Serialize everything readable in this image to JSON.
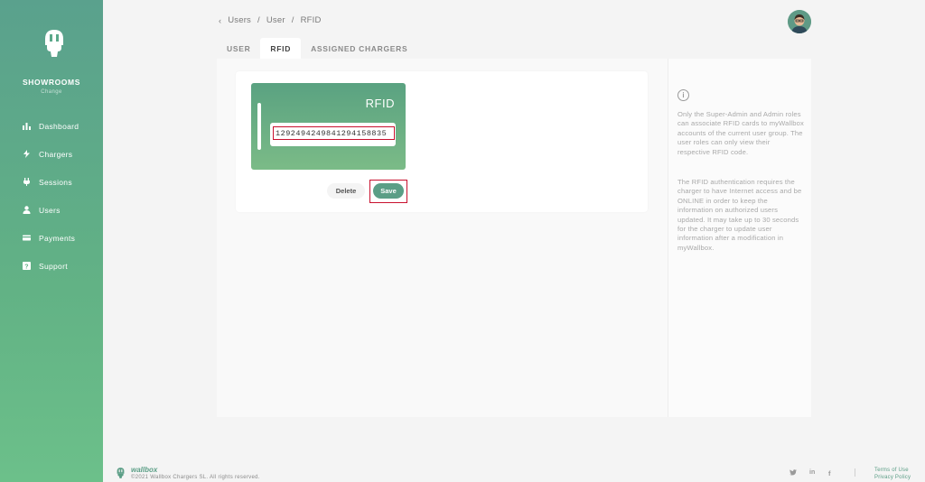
{
  "sidebar": {
    "group_name": "SHOWROOMS",
    "group_change": "Change",
    "items": [
      {
        "label": "Dashboard",
        "icon": "bar-chart-icon"
      },
      {
        "label": "Chargers",
        "icon": "lightning-icon"
      },
      {
        "label": "Sessions",
        "icon": "plug-icon"
      },
      {
        "label": "Users",
        "icon": "user-icon"
      },
      {
        "label": "Payments",
        "icon": "credit-card-icon"
      },
      {
        "label": "Support",
        "icon": "question-icon"
      }
    ]
  },
  "breadcrumb": {
    "items": [
      "Users",
      "/",
      "User",
      "/",
      "RFID"
    ]
  },
  "tabs": [
    {
      "label": "USER",
      "active": false
    },
    {
      "label": "RFID",
      "active": true
    },
    {
      "label": "ASSIGNED CHARGERS",
      "active": false
    }
  ],
  "rfid_card": {
    "title": "RFID",
    "code": "1292494249841294158835"
  },
  "actions": {
    "delete_label": "Delete",
    "save_label": "Save"
  },
  "info": {
    "p1": "Only the Super-Admin and Admin roles can associate RFID cards to myWallbox accounts of the current user group. The user roles can only view their respective RFID code.",
    "p2": "The RFID authentication requires the charger to have Internet access and be ONLINE in order to keep the information on authorized users updated. It may take up to 30 seconds for the charger to update user information after a modification in myWallbox."
  },
  "footer": {
    "brand": "wallbox",
    "copyright": "©2021 Wallbox Chargers SL. All rights reserved.",
    "social": [
      "twitter-icon",
      "linkedin-icon",
      "facebook-icon"
    ],
    "terms": "Terms of Use",
    "privacy": "Privacy Policy"
  },
  "colors": {
    "brand_green": "#5b9e86",
    "highlight_red": "#c8102e"
  }
}
